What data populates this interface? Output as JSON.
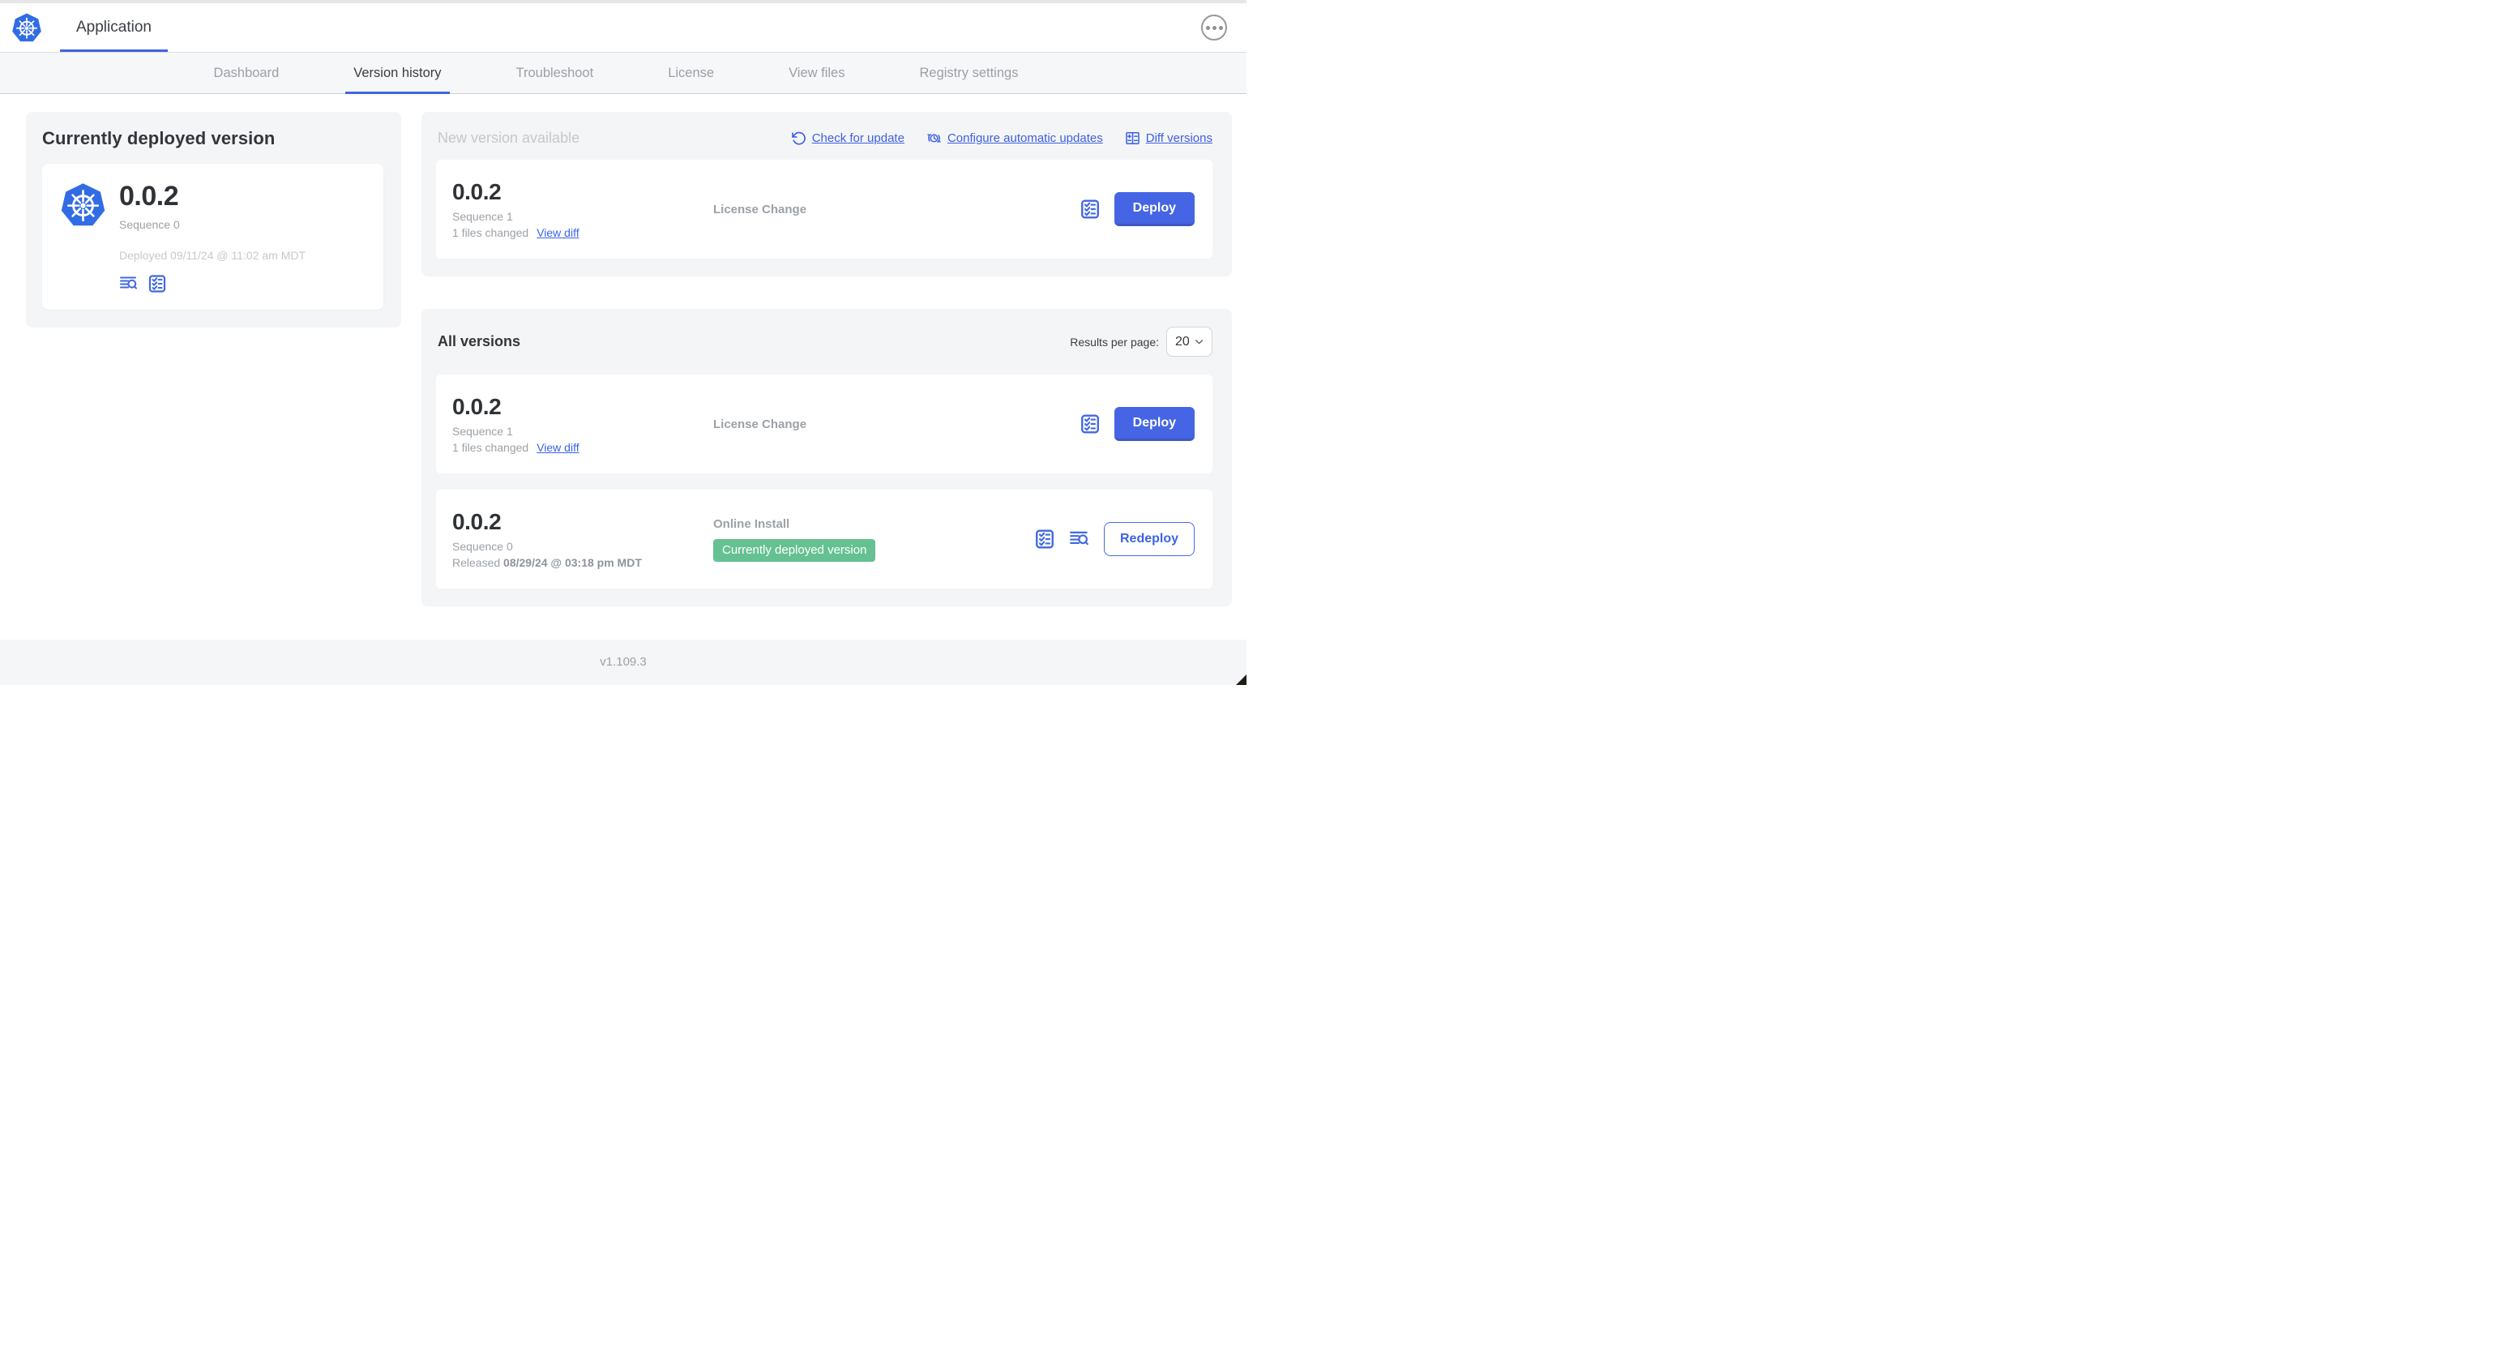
{
  "header": {
    "app_title": "Application"
  },
  "nav": {
    "tabs": [
      {
        "label": "Dashboard",
        "active": false
      },
      {
        "label": "Version history",
        "active": true
      },
      {
        "label": "Troubleshoot",
        "active": false
      },
      {
        "label": "License",
        "active": false
      },
      {
        "label": "View files",
        "active": false
      },
      {
        "label": "Registry settings",
        "active": false
      }
    ]
  },
  "current_version": {
    "panel_title": "Currently deployed version",
    "version": "0.0.2",
    "sequence": "Sequence 0",
    "deployed": "Deployed 09/11/24 @ 11:02 am MDT"
  },
  "new_version": {
    "panel_title": "New version available",
    "actions": [
      {
        "label": "Check for update",
        "icon": "refresh-icon"
      },
      {
        "label": "Configure automatic updates",
        "icon": "clock-refresh-icon"
      },
      {
        "label": "Diff versions",
        "icon": "diff-icon"
      }
    ],
    "row": {
      "version": "0.0.2",
      "sequence": "Sequence 1",
      "files_changed": "1 files changed",
      "view_diff_label": "View diff",
      "source": "License Change",
      "action_label": "Deploy"
    }
  },
  "all_versions": {
    "panel_title": "All versions",
    "results_per_page_label": "Results per page:",
    "results_per_page_value": "20",
    "rows": [
      {
        "version": "0.0.2",
        "sequence": "Sequence 1",
        "files_changed": "1 files changed",
        "view_diff_label": "View diff",
        "source": "License Change",
        "action_label": "Deploy"
      },
      {
        "version": "0.0.2",
        "sequence": "Sequence 0",
        "released_label": "Released ",
        "released_date": "08/29/24 @ 03:18 pm MDT",
        "source": "Online Install",
        "badge": "Currently deployed version",
        "action_label": "Redeploy"
      }
    ]
  },
  "footer": {
    "version": "v1.109.3"
  },
  "colors": {
    "accent_blue": "#4264e0",
    "link_blue": "#3c5fe0",
    "k8s_blue": "#326ce5",
    "badge_green": "#65c191",
    "panel_gray": "#f4f5f7",
    "muted_text": "#9ca1a6",
    "faint_text": "#c6c9cc"
  }
}
